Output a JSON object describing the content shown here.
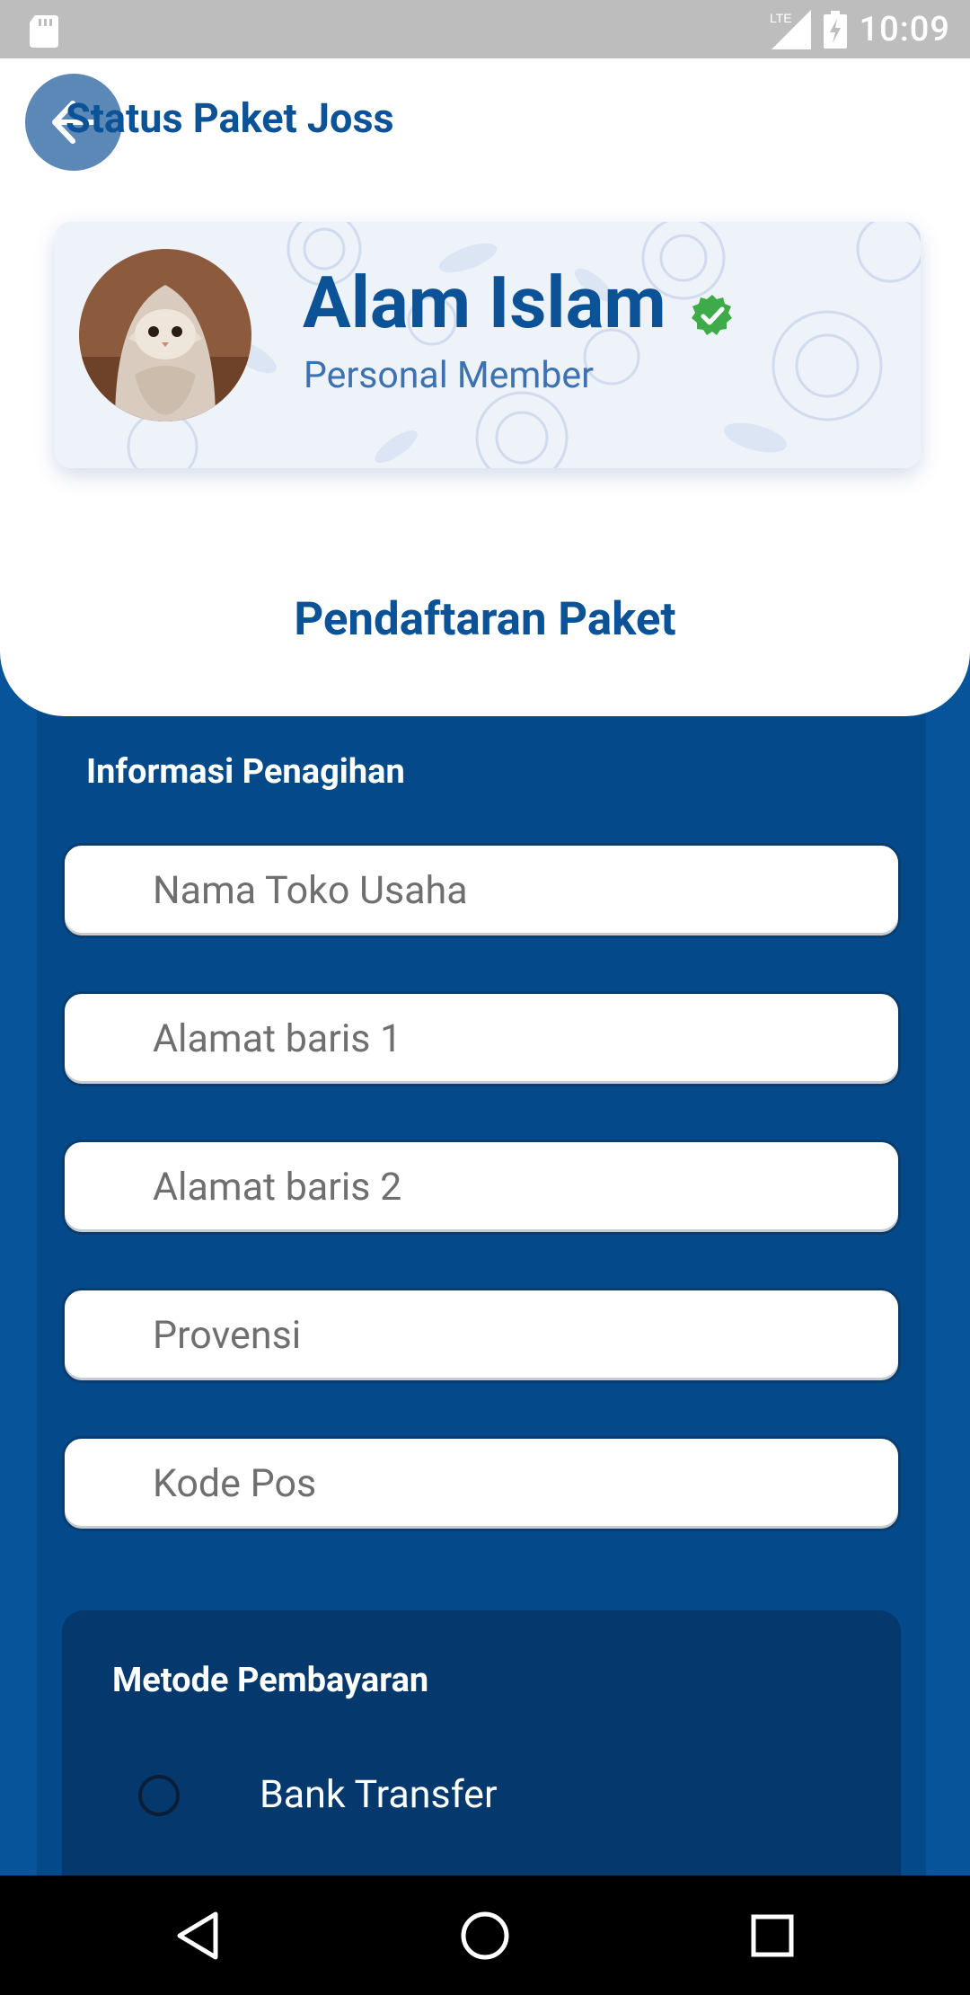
{
  "status_bar": {
    "network": "LTE",
    "time": "10:09"
  },
  "header": {
    "title": "Status Paket Joss",
    "back_icon": "arrow-left-icon"
  },
  "profile": {
    "name": "Alam Islam",
    "role": "Personal Member",
    "verified_icon": "verified-check-icon"
  },
  "section_title": "Pendaftaran Paket",
  "billing": {
    "title": "Informasi Penagihan",
    "fields": [
      {
        "placeholder": "Nama Toko Usaha",
        "value": ""
      },
      {
        "placeholder": "Alamat baris 1",
        "value": ""
      },
      {
        "placeholder": "Alamat baris 2",
        "value": ""
      },
      {
        "placeholder": "Provensi",
        "value": ""
      },
      {
        "placeholder": "Kode Pos",
        "value": ""
      }
    ]
  },
  "payment": {
    "title": "Metode Pembayaran",
    "options": [
      {
        "label": "Bank Transfer",
        "selected": false
      }
    ]
  },
  "colors": {
    "primary": "#0b5296",
    "background": "#07549a",
    "panel": "#044a8a",
    "payment_card": "#05386c",
    "verified": "#3faa4a"
  }
}
